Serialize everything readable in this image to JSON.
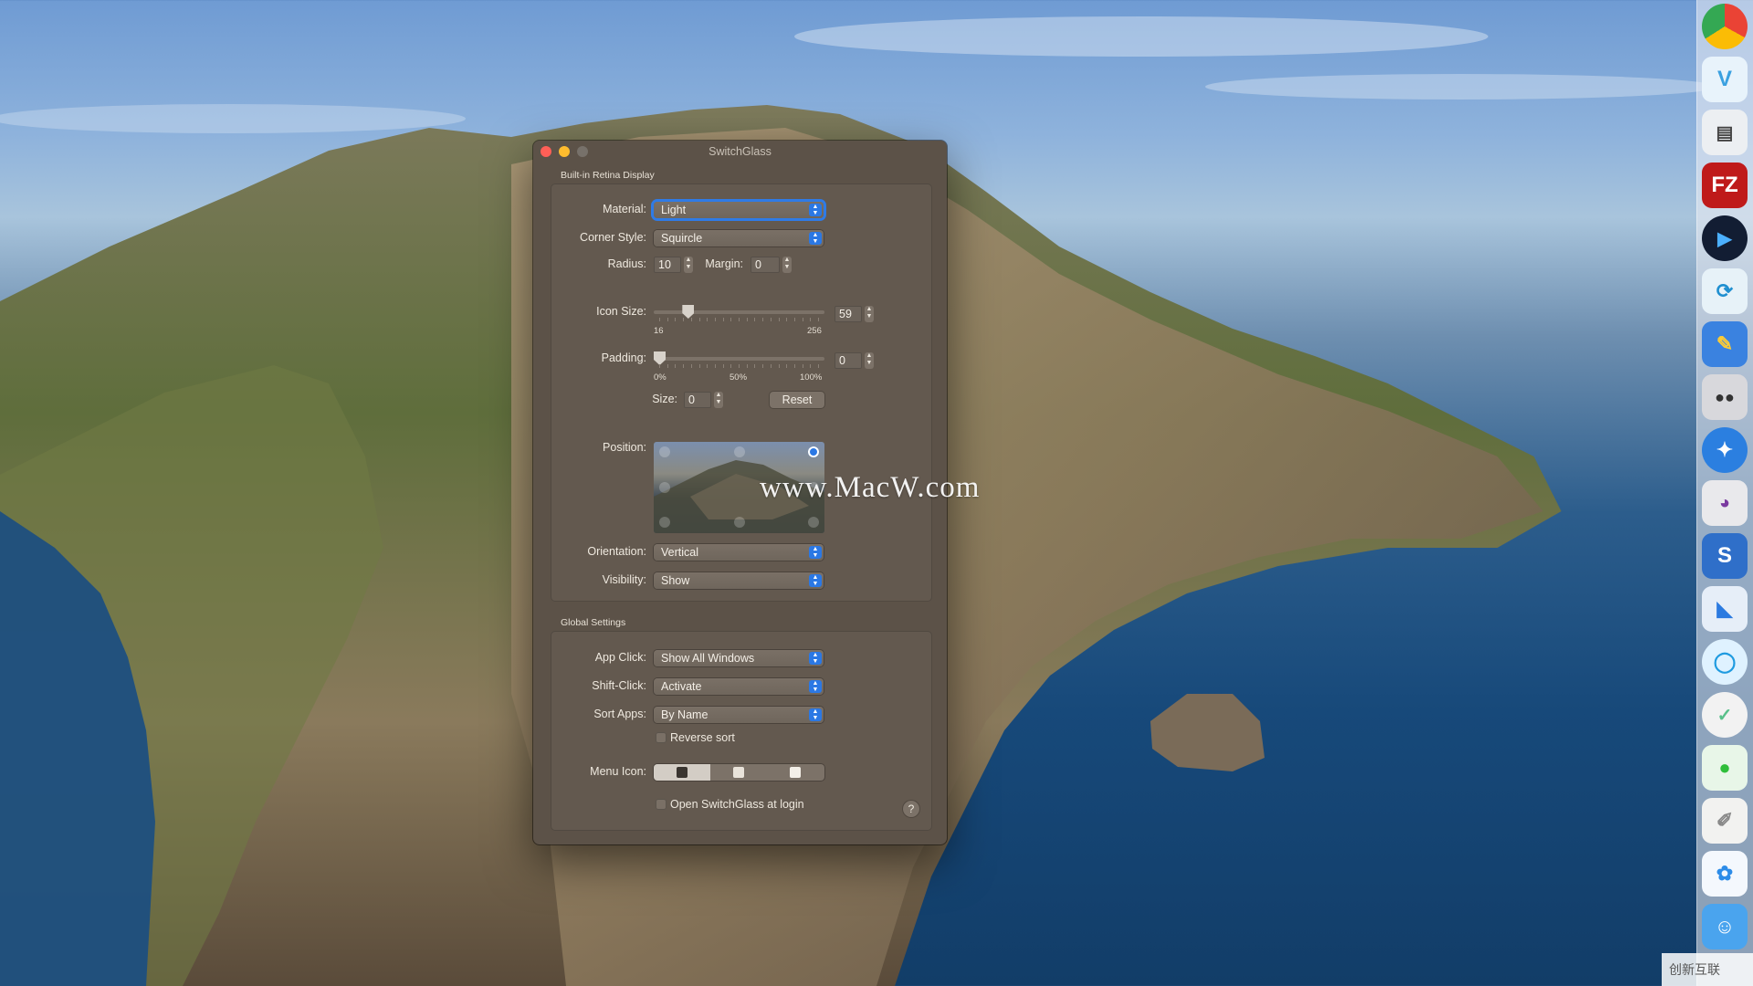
{
  "window": {
    "title": "SwitchGlass",
    "display_section": {
      "title": "Built-in Retina Display",
      "material": {
        "label": "Material:",
        "value": "Light"
      },
      "corner_style": {
        "label": "Corner Style:",
        "value": "Squircle"
      },
      "radius": {
        "label": "Radius:",
        "value": "10"
      },
      "margin": {
        "label": "Margin:",
        "value": "0"
      },
      "icon_size": {
        "label": "Icon Size:",
        "value": "59",
        "min_label": "16",
        "max_label": "256",
        "level": 0.18
      },
      "padding": {
        "label": "Padding:",
        "value": "0",
        "tick_labels": [
          "0%",
          "50%",
          "100%"
        ],
        "level": 0.0
      },
      "size": {
        "label": "Size:",
        "value": "0"
      },
      "reset_label": "Reset",
      "position": {
        "label": "Position:",
        "selected": "top-right"
      },
      "orientation": {
        "label": "Orientation:",
        "value": "Vertical"
      },
      "visibility": {
        "label": "Visibility:",
        "value": "Show"
      }
    },
    "global_section": {
      "title": "Global Settings",
      "app_click": {
        "label": "App Click:",
        "value": "Show All Windows"
      },
      "shift_click": {
        "label": "Shift-Click:",
        "value": "Activate"
      },
      "sort_apps": {
        "label": "Sort Apps:",
        "value": "By Name"
      },
      "reverse_sort": {
        "label": "Reverse sort",
        "checked": false
      },
      "menu_icon": {
        "label": "Menu Icon:",
        "options": [
          "app-grid-icon",
          "app-plus-icon",
          "app-pencil-icon"
        ],
        "selected_index": 0
      },
      "open_at_login": {
        "label": "Open SwitchGlass at login",
        "checked": false
      },
      "help_label": "?"
    }
  },
  "watermark": "www.MacW.com",
  "corner_logo": "创新互联",
  "dock": {
    "apps": [
      "chrome-icon",
      "vectornator-icon",
      "printer-icon",
      "filezilla-icon",
      "infuse-icon",
      "sync-icon",
      "pages-icon",
      "robot-icon",
      "safari-icon",
      "games-icon",
      "scrivener-icon",
      "finder-mail-icon",
      "messages-icon",
      "ticktick-icon",
      "wechat-icon",
      "textedit-icon",
      "baidu-netdisk-icon",
      "finder-icon"
    ],
    "filezilla_text": "FZ",
    "scrivener_text": "S"
  }
}
